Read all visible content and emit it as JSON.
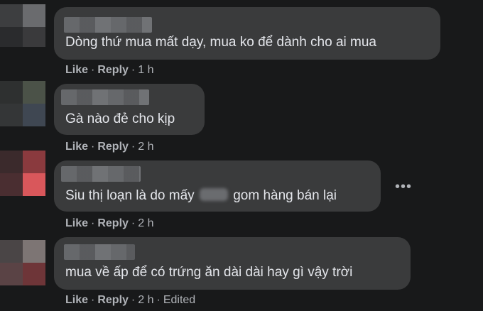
{
  "comments": [
    {
      "text": "Dòng thứ mua mất dạy, mua ko để dành cho ai mua",
      "actions": {
        "like": "Like",
        "reply": "Reply",
        "time": "1 h"
      },
      "avatar_colors": [
        "#3d3e40",
        "#6a6b6e",
        "#2a2b2d",
        "#3a3a3c"
      ]
    },
    {
      "text": "Gà nào đẻ cho kịp",
      "actions": {
        "like": "Like",
        "reply": "Reply",
        "time": "2 h"
      },
      "avatar_colors": [
        "#2e3030",
        "#4b5248",
        "#343637",
        "#3f4752"
      ]
    },
    {
      "text_before": "Siu thị loạn là do mấy",
      "text_after": "gom hàng bán lại",
      "actions": {
        "like": "Like",
        "reply": "Reply",
        "time": "2 h"
      },
      "avatar_colors": [
        "#3b2a2c",
        "#8a3a3e",
        "#4a2e31",
        "#d9575b"
      ]
    },
    {
      "text": "mua về ấp để có trứng ăn dài dài hay gì vậy trời",
      "actions": {
        "like": "Like",
        "reply": "Reply",
        "time": "2 h",
        "edited": "Edited"
      },
      "avatar_colors": [
        "#4a4546",
        "#7d7574",
        "#5a4345",
        "#6e3538"
      ]
    }
  ],
  "more_icon": "horizontal-ellipsis-icon",
  "colors": {
    "background": "#18191a",
    "bubble": "#3a3b3c",
    "text": "#e4e6eb",
    "secondary": "#b0b3b8"
  }
}
